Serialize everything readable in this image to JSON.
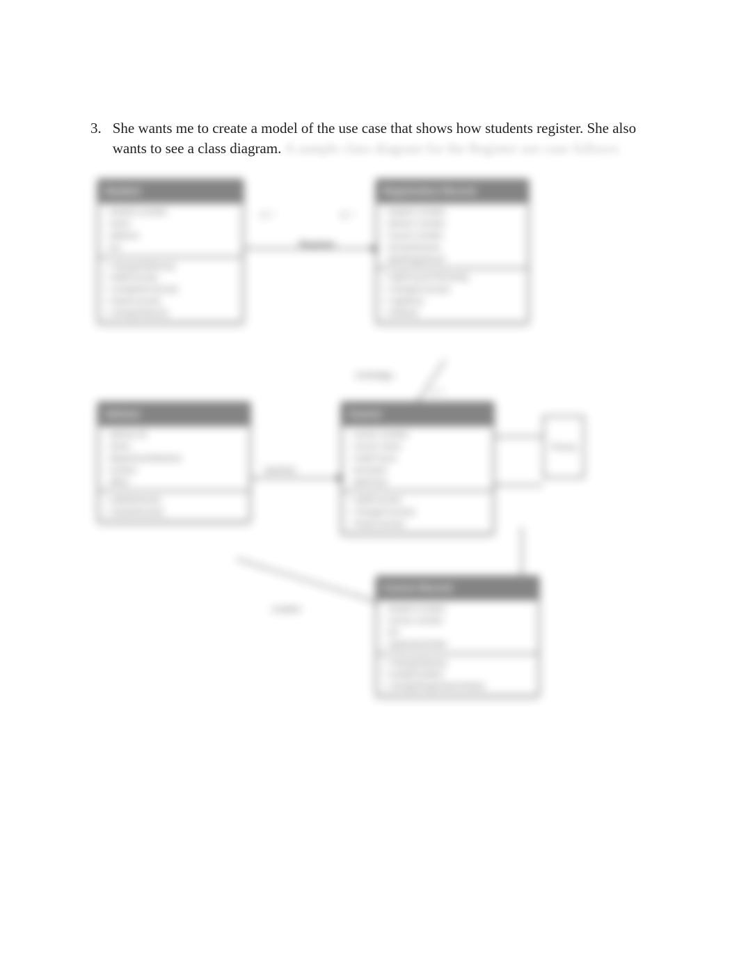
{
  "question": {
    "number": "3.",
    "prompt": "She wants me to create a model of the use case that shows how students register. She also wants to see a class diagram.",
    "blurredSuffix": "A sample class diagram for the Register  use case follows:"
  },
  "diagram": {
    "classes": {
      "student": {
        "title": "Student",
        "attrs": [
          "- student number",
          "- name",
          "- address",
          "- etc."
        ],
        "ops": [
          "+ changeAddress()",
          "+ addCourse()",
          "+ completeCourse()",
          "+ dropCourse()",
          "+ changeStatus()"
        ]
      },
      "registrationRecord": {
        "title": "Registration Record",
        "attrs": [
          "- student number",
          "- advisor number",
          "- course number",
          "- semester/year",
          "- dateRegistered"
        ],
        "ops": [
          "+ addCourseToSched()",
          "+ changeCourse()",
          "+ register()",
          "+ delete()"
        ]
      },
      "advisor": {
        "title": "Advisor",
        "attrs": [
          "- advisor ID",
          "- name",
          "- department/division",
          "- contact",
          "- office"
        ],
        "ops": [
          "+ addAdvisee()",
          "+ dropAdvisee()"
        ]
      },
      "course": {
        "title": "Course",
        "attrs": [
          "- course number",
          "- course name",
          "- credit hours",
          "- semester",
          "- dateTime"
        ],
        "ops": [
          "+ addCourse()",
          "+ changeCourse()",
          "+ dropCourse()"
        ]
      },
      "courseRecord": {
        "title": "Course Record",
        "attrs": [
          "- student number",
          "- course number",
          "- etc.",
          "- registrationDate"
        ],
        "ops": [
          "+ changeStatus()",
          "+ assignGrade()",
          "+ changeRegistrationDate()"
        ]
      }
    },
    "associations": {
      "register": {
        "label": "Register",
        "leftMult": "0..*",
        "rightMult": "0..*"
      },
      "scheduleRel": {
        "label": "schedule"
      },
      "teaches": {
        "label": "teaches"
      },
      "creates": {
        "label": "creates"
      },
      "prereq": {
        "label": "Prereq"
      }
    }
  }
}
